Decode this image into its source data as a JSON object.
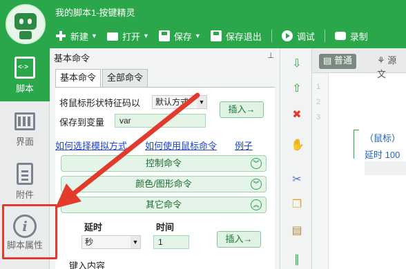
{
  "window": {
    "title": "我的脚本1-按键精灵"
  },
  "toolbar": {
    "new": "新建",
    "open": "打开",
    "save": "保存",
    "save_exit": "保存退出",
    "debug": "调试",
    "record": "录制"
  },
  "leftnav": {
    "items": [
      {
        "label": "脚本",
        "icon": "script-icon"
      },
      {
        "label": "界面",
        "icon": "layout-icon"
      },
      {
        "label": "附件",
        "icon": "attachment-icon"
      },
      {
        "label": "脚本属性",
        "icon": "info-icon"
      }
    ]
  },
  "panel": {
    "title": "基本命令",
    "tabs": [
      "基本命令",
      "全部命令"
    ],
    "mouse_label": "将鼠标形状特征码以",
    "mouse_mode": "默认方式",
    "save_var_label": "保存到变量",
    "var_value": "var",
    "insert": "插入→",
    "links": [
      "如何选择模拟方式",
      "如何使用鼠标命令",
      "例子"
    ],
    "sections": [
      "控制命令",
      "颜色/图形命令",
      "其它命令"
    ],
    "delay_label": "延时",
    "time_label": "时间",
    "unit": "秒",
    "time_value": "1",
    "next_label": "键入内容"
  },
  "editor": {
    "tabs": [
      "普通",
      "源文"
    ],
    "lines": [
      "1",
      "2",
      "3"
    ],
    "code_line1": "（鼠标）",
    "code_line2": "延时 100"
  },
  "colors": {
    "brand": "#2aa74a",
    "highlight": "#e23b2e",
    "link": "#1a43c8"
  }
}
